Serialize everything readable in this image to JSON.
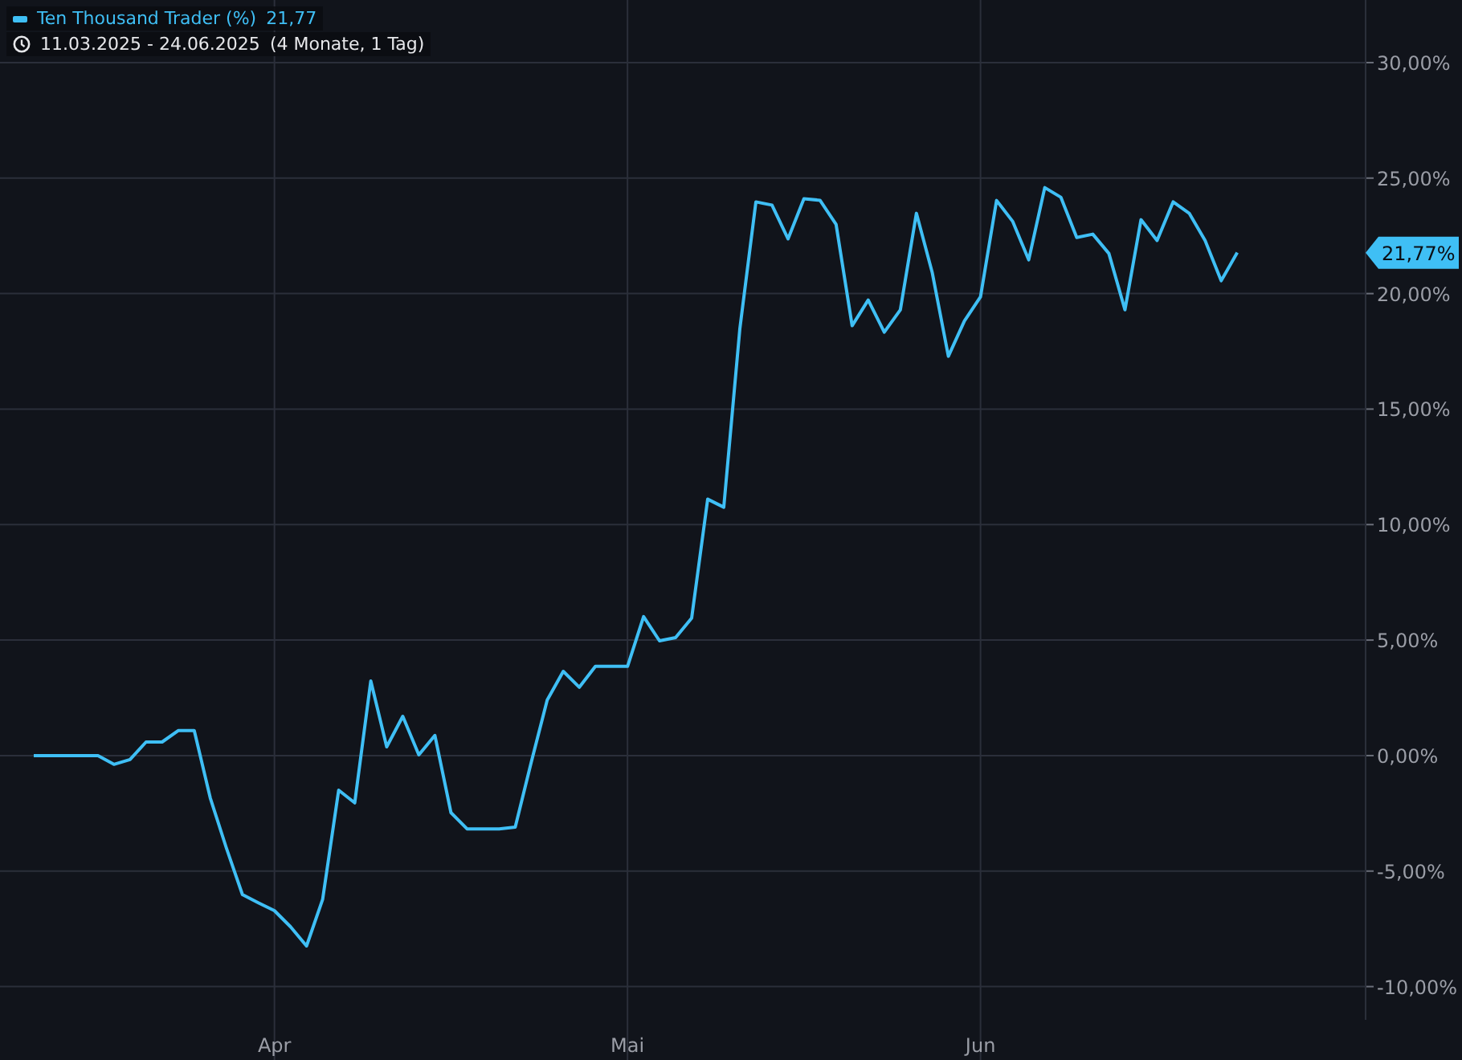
{
  "legend": {
    "series_value": "21,77",
    "date_range": "11.03.2025 - 24.06.2025",
    "duration": "(4 Monate, 1 Tag)"
  },
  "chart": {
    "current_label": "21,77%",
    "chart_data": {
      "type": "line",
      "categories": [
        null,
        null,
        null,
        null,
        null,
        null,
        null,
        null,
        null,
        null,
        null,
        null,
        null,
        null,
        null,
        "Apr",
        null,
        null,
        null,
        null,
        null,
        null,
        null,
        null,
        null,
        null,
        null,
        null,
        null,
        null,
        null,
        null,
        null,
        null,
        null,
        null,
        null,
        "Mai",
        null,
        null,
        null,
        null,
        null,
        null,
        null,
        null,
        null,
        null,
        null,
        null,
        null,
        null,
        null,
        null,
        null,
        null,
        null,
        null,
        null,
        "Jun",
        null,
        null,
        null,
        null,
        null,
        null,
        null,
        null,
        null,
        null,
        null,
        null,
        null,
        null,
        null,
        null
      ],
      "series": [
        {
          "name": "Ten Thousand Trader (%)",
          "color": "#3fbff5",
          "values": [
            0,
            0,
            0,
            0,
            0,
            -0.38,
            -0.17,
            0.59,
            0.59,
            1.08,
            1.08,
            -1.84,
            -4.0,
            -6.02,
            -6.37,
            -6.71,
            -7.41,
            -8.24,
            -6.23,
            -1.5,
            -2.05,
            3.23,
            0.38,
            1.7,
            0.03,
            0.87,
            -2.47,
            -3.17,
            -3.17,
            -3.17,
            -3.1,
            -0.31,
            2.4,
            3.65,
            2.96,
            3.86,
            3.86,
            3.86,
            6.02,
            4.97,
            5.11,
            5.95,
            11.1,
            10.75,
            18.47,
            23.97,
            23.83,
            22.37,
            24.11,
            24.04,
            23.0,
            18.61,
            19.72,
            18.33,
            19.3,
            23.48,
            20.9,
            17.29,
            18.82,
            19.86,
            24.03,
            23.13,
            21.46,
            24.59,
            24.17,
            22.43,
            22.57,
            21.74,
            19.3,
            23.2,
            22.3,
            23.97,
            23.48,
            22.3,
            20.56,
            21.77
          ]
        }
      ],
      "grid": true,
      "ylim": [
        -11.44,
        32.71
      ],
      "yticks": [
        {
          "value": 30,
          "label": "30,00%"
        },
        {
          "value": 25,
          "label": "25,00%"
        },
        {
          "value": 20,
          "label": "20,00%"
        },
        {
          "value": 15,
          "label": "15,00%"
        },
        {
          "value": 10,
          "label": "10,00%"
        },
        {
          "value": 5,
          "label": "5,00%"
        },
        {
          "value": 0,
          "label": "0,00%"
        },
        {
          "value": -5,
          "label": "-5,00%"
        },
        {
          "value": -10,
          "label": "-10,00%"
        }
      ]
    }
  }
}
